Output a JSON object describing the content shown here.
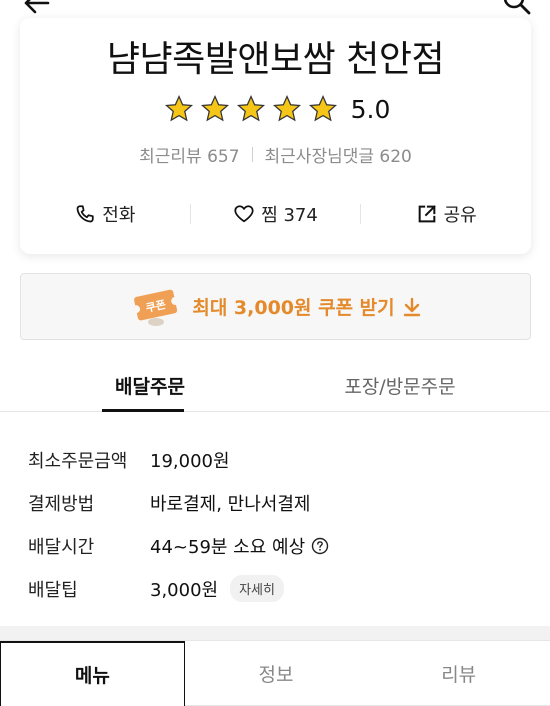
{
  "store": {
    "name": "냠냠족발앤보쌈 천안점",
    "rating": "5.0",
    "stars_filled": 5,
    "stars_total": 5
  },
  "reviews": {
    "recent_reviews": "최근리뷰 657",
    "owner_replies": "최근사장님댓글 620"
  },
  "actions": {
    "call": "전화",
    "like": "찜 374",
    "share": "공유"
  },
  "coupon": {
    "label": "최대 3,000원 쿠폰 받기",
    "badge": "쿠폰"
  },
  "order_tabs": {
    "delivery": "배달주문",
    "pickup": "포장/방문주문"
  },
  "info": [
    {
      "label": "최소주문금액",
      "value": "19,000원"
    },
    {
      "label": "결제방법",
      "value": "바로결제, 만나서결제"
    },
    {
      "label": "배달시간",
      "value": "44~59분 소요 예상"
    },
    {
      "label": "배달팁",
      "value": "3,000원",
      "detail": "자세히"
    }
  ],
  "bottom_tabs": {
    "menu": "메뉴",
    "info": "정보",
    "review": "리뷰"
  },
  "colors": {
    "star": "#f5c518",
    "coupon_accent": "#e48a2b"
  },
  "icons": {
    "back": "arrow-left-icon",
    "search": "search-icon",
    "call": "phone-icon",
    "like": "heart-icon",
    "share": "share-icon",
    "coupon": "coupon-ticket-icon",
    "download": "download-arrow-icon",
    "help": "question-circle-icon"
  }
}
